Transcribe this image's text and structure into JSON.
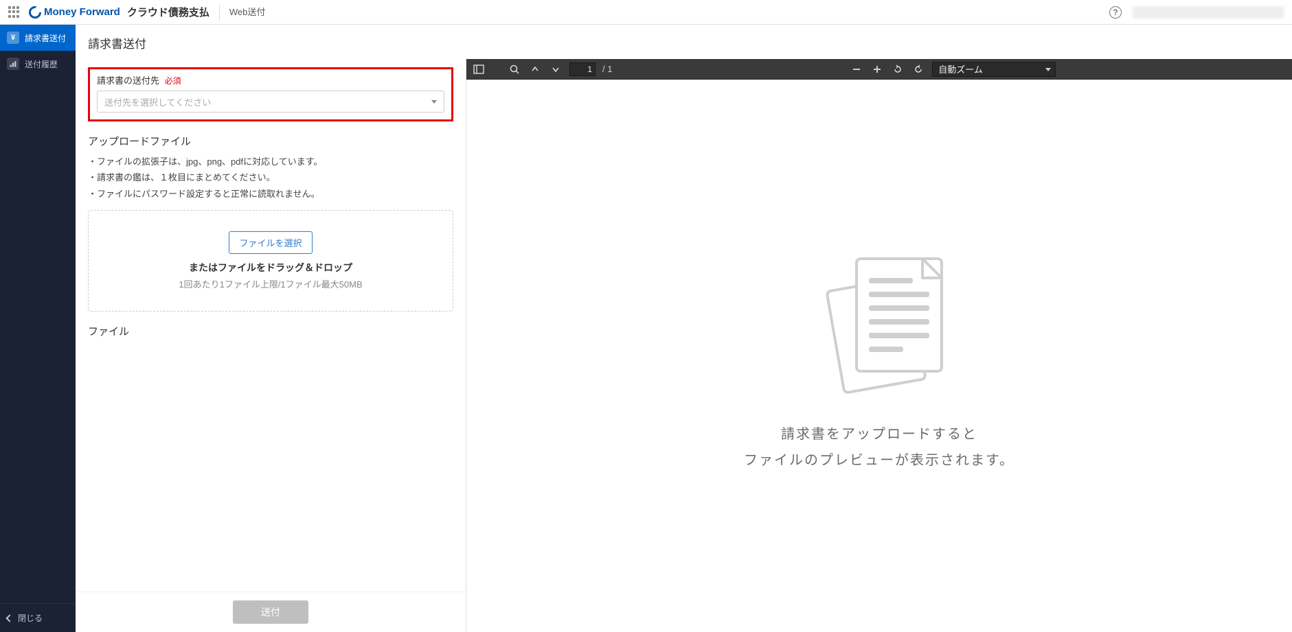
{
  "header": {
    "logo_text": "Money Forward",
    "product": "クラウド債務支払",
    "sub_product": "Web送付"
  },
  "sidebar": {
    "items": [
      {
        "label": "請求書送付",
        "icon": "¥"
      },
      {
        "label": "送付履歴",
        "icon": ""
      }
    ],
    "close_label": "閉じる"
  },
  "page": {
    "title": "請求書送付"
  },
  "form": {
    "destination": {
      "label": "請求書の送付先",
      "required_tag": "必須",
      "placeholder": "送付先を選択してください"
    },
    "upload": {
      "section_title": "アップロードファイル",
      "bullets": [
        "ファイルの拡張子は、jpg、png、pdfに対応しています。",
        "請求書の鑑は、１枚目にまとめてください。",
        "ファイルにパスワード設定すると正常に読取れません。"
      ],
      "choose_button": "ファイルを選択",
      "drag_text": "またはファイルをドラッグ＆ドロップ",
      "limit_text": "1回あたり1ファイル上限/1ファイル最大50MB"
    },
    "file_section_title": "ファイル",
    "submit_label": "送付"
  },
  "viewer": {
    "page_current": "1",
    "page_total": "/ 1",
    "zoom_label": "自動ズーム",
    "empty_line1": "請求書をアップロードすると",
    "empty_line2": "ファイルのプレビューが表示されます。"
  }
}
